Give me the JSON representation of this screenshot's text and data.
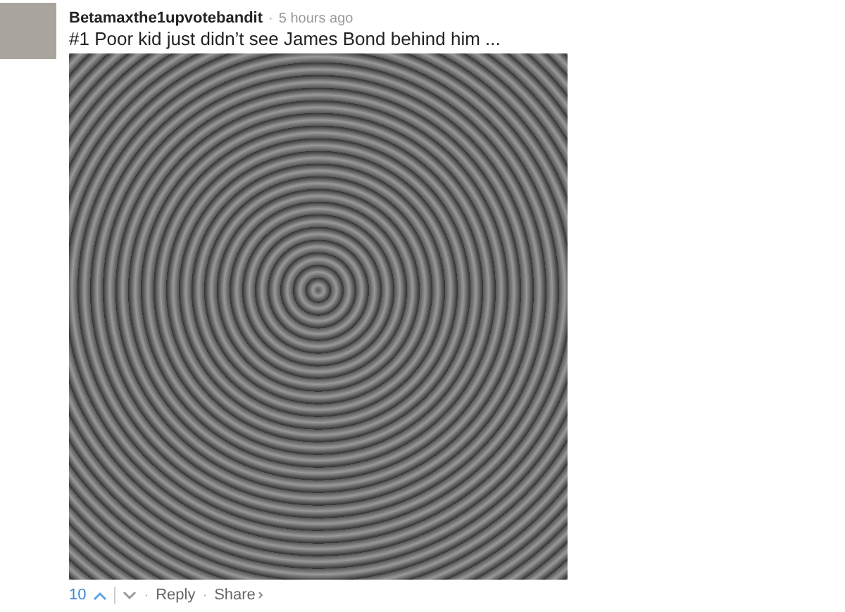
{
  "comment": {
    "author": "Betamaxthe1upvotebandit",
    "separator": "·",
    "time": "5 hours ago",
    "text": "#1 Poor kid just didn’t see James Bond behind him ...",
    "votes": "10",
    "actions": [
      "Reply",
      "Share"
    ]
  }
}
